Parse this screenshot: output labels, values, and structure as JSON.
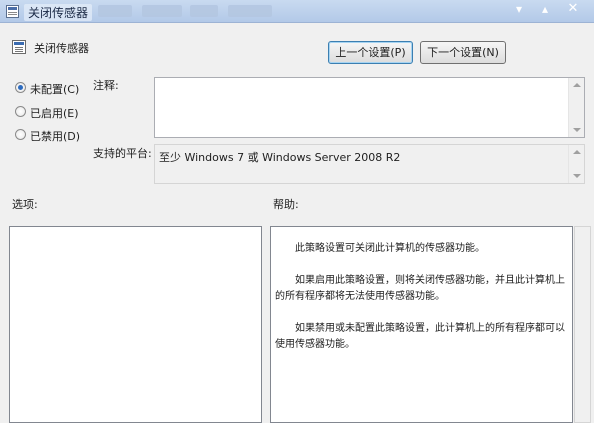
{
  "window": {
    "title": "关闭传感器",
    "controls": {
      "minimize": "▾",
      "maximize": "▴",
      "close": "✕"
    }
  },
  "header": {
    "title": "关闭传感器",
    "prev_button": "上一个设置(P)",
    "next_button": "下一个设置(N)"
  },
  "options": [
    {
      "label": "未配置(C)",
      "checked": true
    },
    {
      "label": "已启用(E)",
      "checked": false
    },
    {
      "label": "已禁用(D)",
      "checked": false
    }
  ],
  "comment": {
    "label": "注释:",
    "value": ""
  },
  "platform": {
    "label": "支持的平台:",
    "value": "至少 Windows 7 或 Windows Server 2008 R2"
  },
  "sections": {
    "options_label": "选项:",
    "help_label": "帮助:"
  },
  "help": {
    "paragraphs": [
      "此策略设置可关闭此计算机的传感器功能。",
      "如果启用此策略设置，则将关闭传感器功能，并且此计算机上的所有程序都将无法使用传感器功能。",
      "如果禁用或未配置此策略设置，此计算机上的所有程序都可以使用传感器功能。"
    ]
  },
  "colors": {
    "titlebar": "#b3c9e8",
    "accent": "#3c7fb1",
    "background": "#f0f0f0"
  },
  "icons": {
    "window": "policy-icon",
    "header": "policy-icon"
  }
}
